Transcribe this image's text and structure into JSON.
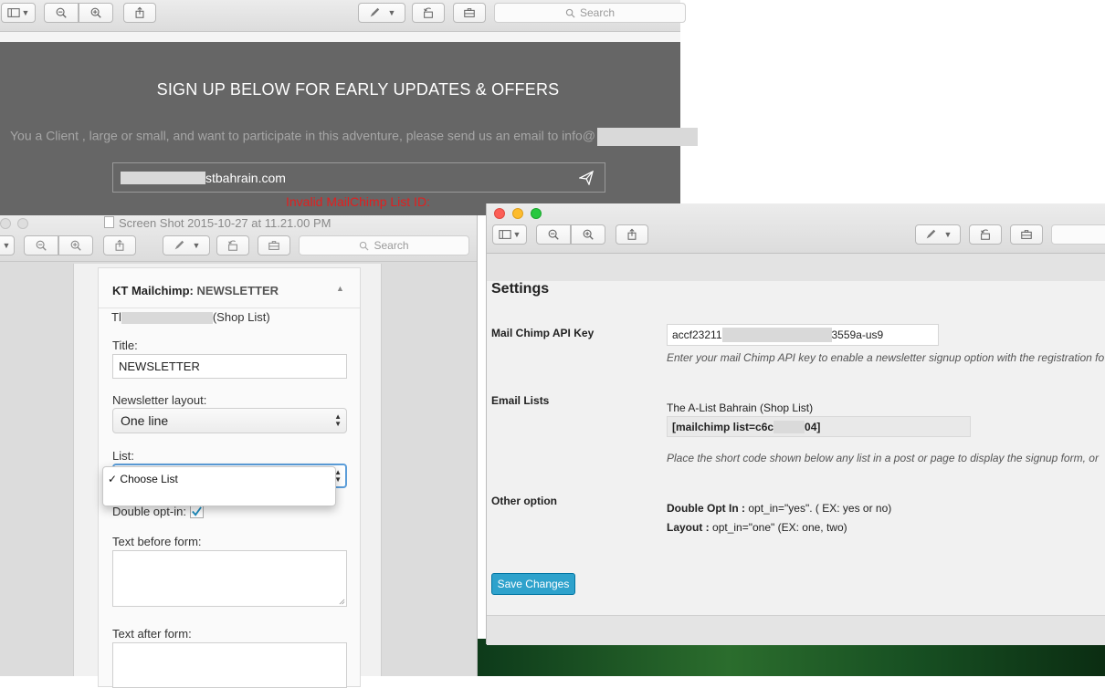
{
  "top_window": {
    "search_placeholder": "Search",
    "banner_heading": "SIGN UP BELOW FOR EARLY UPDATES & OFFERS",
    "banner_text": "You a Client , large or small, and want to participate in this adventure, please send us an email to info@",
    "email_value_suffix": "stbahrain.com",
    "error_text": "Invalid MailChimp List ID:"
  },
  "left_window": {
    "title": "Screen Shot 2015-10-27 at 11.21.00 PM",
    "search_placeholder": "Search",
    "widget": {
      "header_prefix": "KT Mailchimp:",
      "header_name": "NEWSLETTER",
      "list_line_start": "Tl",
      "list_line_end": "(Shop List)",
      "title_label": "Title:",
      "title_value": "NEWSLETTER",
      "layout_label": "Newsletter layout:",
      "layout_value": "One line",
      "list_label": "List:",
      "dropdown_option": "Choose List",
      "double_optin_label": "Double opt-in:",
      "text_before_label": "Text before form:",
      "text_after_label": "Text after form:"
    }
  },
  "right_window": {
    "settings_title": "Settings",
    "api_key_label": "Mail Chimp API Key",
    "api_key_start": "accf23211",
    "api_key_end": "3559a-us9",
    "api_key_help": "Enter your mail Chimp API key to enable a newsletter signup option with the registration fo",
    "email_lists_label": "Email Lists",
    "list_name": "The A-List Bahrain (Shop List)",
    "shortcode_start": "[mailchimp list=c6c",
    "shortcode_end": "04]",
    "shortcode_help": "Place the short code shown below any list in a post or page to display the signup form, or",
    "other_option_label": "Other option",
    "double_optin_key": "Double Opt In :",
    "double_optin_value": "opt_in=\"yes\". ( EX: yes or no)",
    "layout_key": "Layout :",
    "layout_value": "opt_in=\"one\" (EX: one, two)",
    "save_button": "Save Changes"
  },
  "colors": {
    "banner_bg": "#666666",
    "error_red": "#e02020",
    "wp_primary": "#2ea2cc",
    "checkbox_blue": "#1e8cbe"
  }
}
